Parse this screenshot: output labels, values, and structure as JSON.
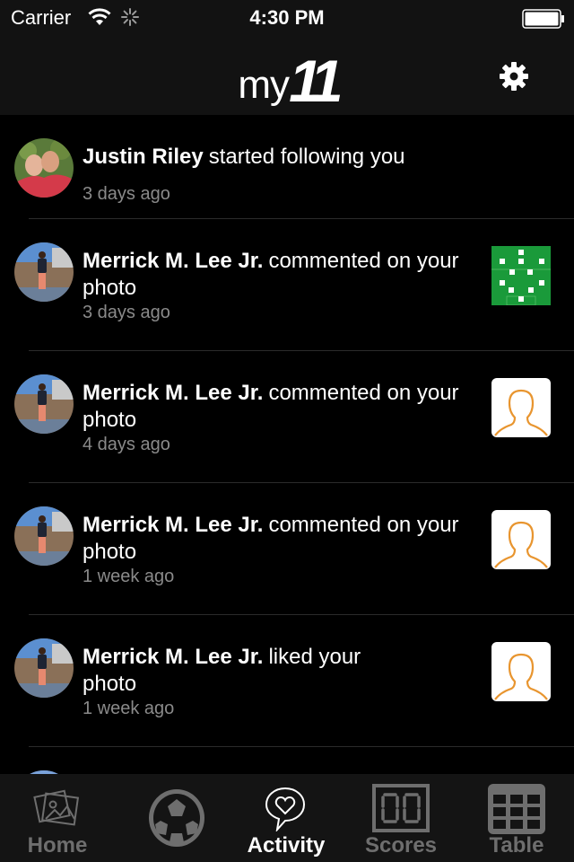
{
  "status_bar": {
    "carrier": "Carrier",
    "time": "4:30 PM"
  },
  "nav": {
    "logo_my": "my",
    "logo_eleven": "11",
    "settings_icon": "gear-icon"
  },
  "feed": {
    "items": [
      {
        "name": "Justin Riley",
        "action": "started following you",
        "ago": "3 days ago",
        "thumb": "none"
      },
      {
        "name": "Merrick M. Lee Jr.",
        "action": "commented on your photo",
        "ago": "3 days ago",
        "thumb": "lineup-photo"
      },
      {
        "name": "Merrick M. Lee Jr.",
        "action": "commented on your photo",
        "ago": "4 days ago",
        "thumb": "placeholder-person"
      },
      {
        "name": "Merrick M. Lee Jr.",
        "action": "commented on your photo",
        "ago": "1 week ago",
        "thumb": "placeholder-person"
      },
      {
        "name": "Merrick M. Lee Jr.",
        "action": "liked your photo",
        "ago": "1 week ago",
        "thumb": "placeholder-person"
      }
    ]
  },
  "tabs": [
    {
      "label": "Home",
      "icon": "photos-icon",
      "active": false
    },
    {
      "label": "",
      "icon": "soccer-ball-icon",
      "active": false
    },
    {
      "label": "Activity",
      "icon": "heart-bubble-icon",
      "active": true
    },
    {
      "label": "Scores",
      "icon": "scoreboard-icon",
      "active": false
    },
    {
      "label": "Table",
      "icon": "table-grid-icon",
      "active": false
    }
  ],
  "colors": {
    "background": "#000000",
    "bar": "#121212",
    "muted_text": "#8a8a8a",
    "inactive_tab": "#6e6e6e",
    "placeholder_orange": "#e8952f",
    "pitch_green": "#1a9a3a"
  }
}
